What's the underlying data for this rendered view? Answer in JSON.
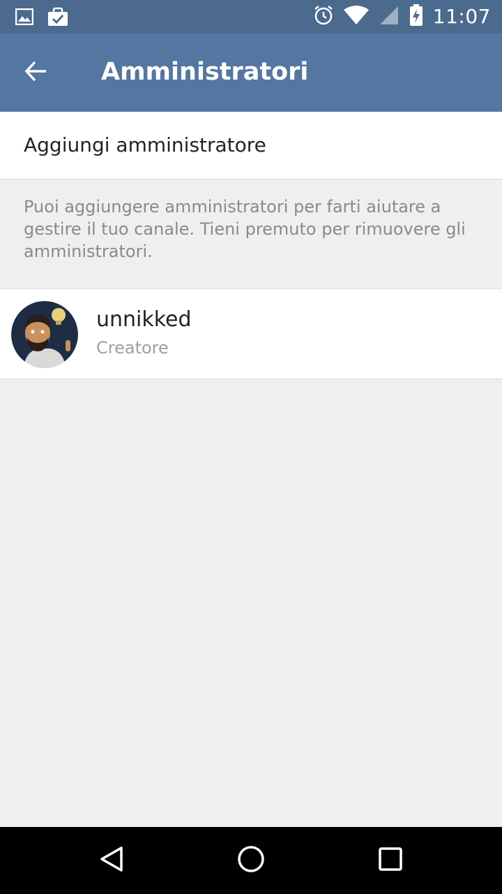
{
  "status_bar": {
    "time": "11:07",
    "left_icons": [
      "gallery-icon",
      "clipboard-check-icon"
    ],
    "right_icons": [
      "alarm-icon",
      "wifi-icon",
      "cell-signal-icon",
      "battery-charging-icon"
    ]
  },
  "toolbar": {
    "title": "Amministratori",
    "back_icon": "arrow-left-icon"
  },
  "add_admin": {
    "label": "Aggiungi amministratore"
  },
  "info": {
    "text": "Puoi aggiungere amministratori per farti aiutare a gestire il tuo canale. Tieni premuto per rimuovere gli amministratori."
  },
  "admins": [
    {
      "name": "unnikked",
      "role": "Creatore"
    }
  ],
  "colors": {
    "status_bar": "#4b6a8e",
    "toolbar": "#5576a0",
    "background": "#efefef",
    "nav_bar": "#000000"
  },
  "nav": {
    "icons": [
      "back-triangle-icon",
      "home-circle-icon",
      "recents-square-icon"
    ]
  }
}
